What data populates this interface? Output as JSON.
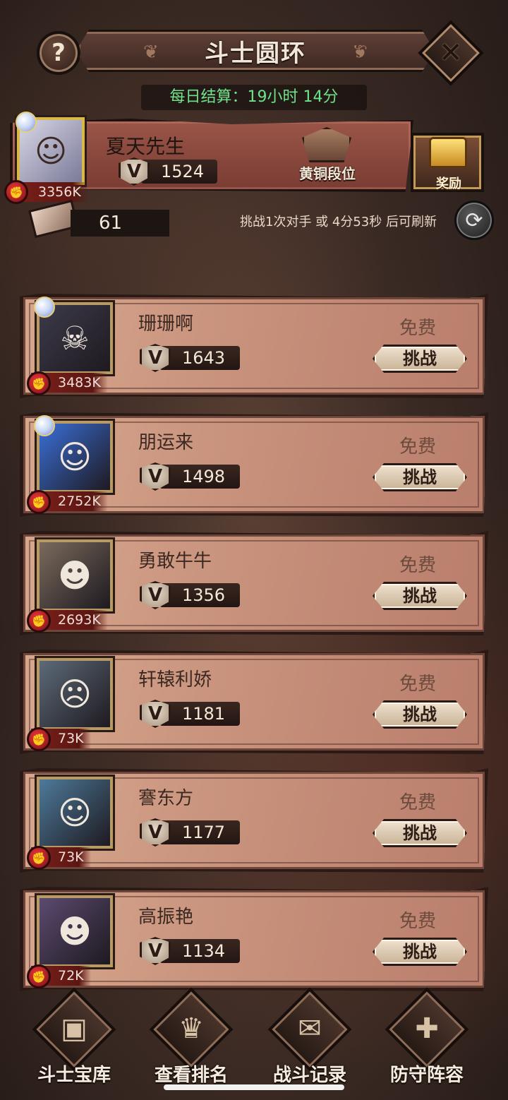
{
  "header": {
    "title": "斗士圆环",
    "help_label": "?",
    "close_label": "✕",
    "settlement": "每日结算：19小时 14分"
  },
  "player": {
    "name": "夏天先生",
    "score": "1524",
    "power": "3356K",
    "rank_label": "黄铜段位",
    "reward_label": "奖励",
    "tickets": "61",
    "refresh_hint": "挑战1次对手 或 4分53秒 后可刷新"
  },
  "opponents": [
    {
      "name": "珊珊啊",
      "score": "1643",
      "power": "3483K",
      "cost": "免费",
      "action": "挑战",
      "avatar_color": "#3d3a4a",
      "avatar_glyph": "☠"
    },
    {
      "name": "朋运来",
      "score": "1498",
      "power": "2752K",
      "cost": "免费",
      "action": "挑战",
      "avatar_color": "#3a6fd8",
      "avatar_glyph": "☺"
    },
    {
      "name": "勇敢牛牛",
      "score": "1356",
      "power": "2693K",
      "cost": "免费",
      "action": "挑战",
      "avatar_color": "#7a6a5c",
      "avatar_glyph": "☻"
    },
    {
      "name": "轩辕利娇",
      "score": "1181",
      "power": "73K",
      "cost": "免费",
      "action": "挑战",
      "avatar_color": "#5d6a78",
      "avatar_glyph": "☹"
    },
    {
      "name": "謇东方",
      "score": "1177",
      "power": "73K",
      "cost": "免费",
      "action": "挑战",
      "avatar_color": "#4d7a9a",
      "avatar_glyph": "☺"
    },
    {
      "name": "高振艳",
      "score": "1134",
      "power": "72K",
      "cost": "免费",
      "action": "挑战",
      "avatar_color": "#5b4a70",
      "avatar_glyph": "☻"
    }
  ],
  "nav": [
    {
      "label": "斗士宝库",
      "icon": "treasure-chest-icon",
      "glyph": "▣"
    },
    {
      "label": "查看排名",
      "icon": "trophy-icon",
      "glyph": "♛"
    },
    {
      "label": "战斗记录",
      "icon": "scroll-icon",
      "glyph": "✉"
    },
    {
      "label": "防守阵容",
      "icon": "shield-icon",
      "glyph": "✚"
    }
  ],
  "colors": {
    "settle_text": "#6fe38a",
    "banner": "#8a4a3e",
    "card": "#c8927c",
    "power_tag": "#7d211b"
  }
}
